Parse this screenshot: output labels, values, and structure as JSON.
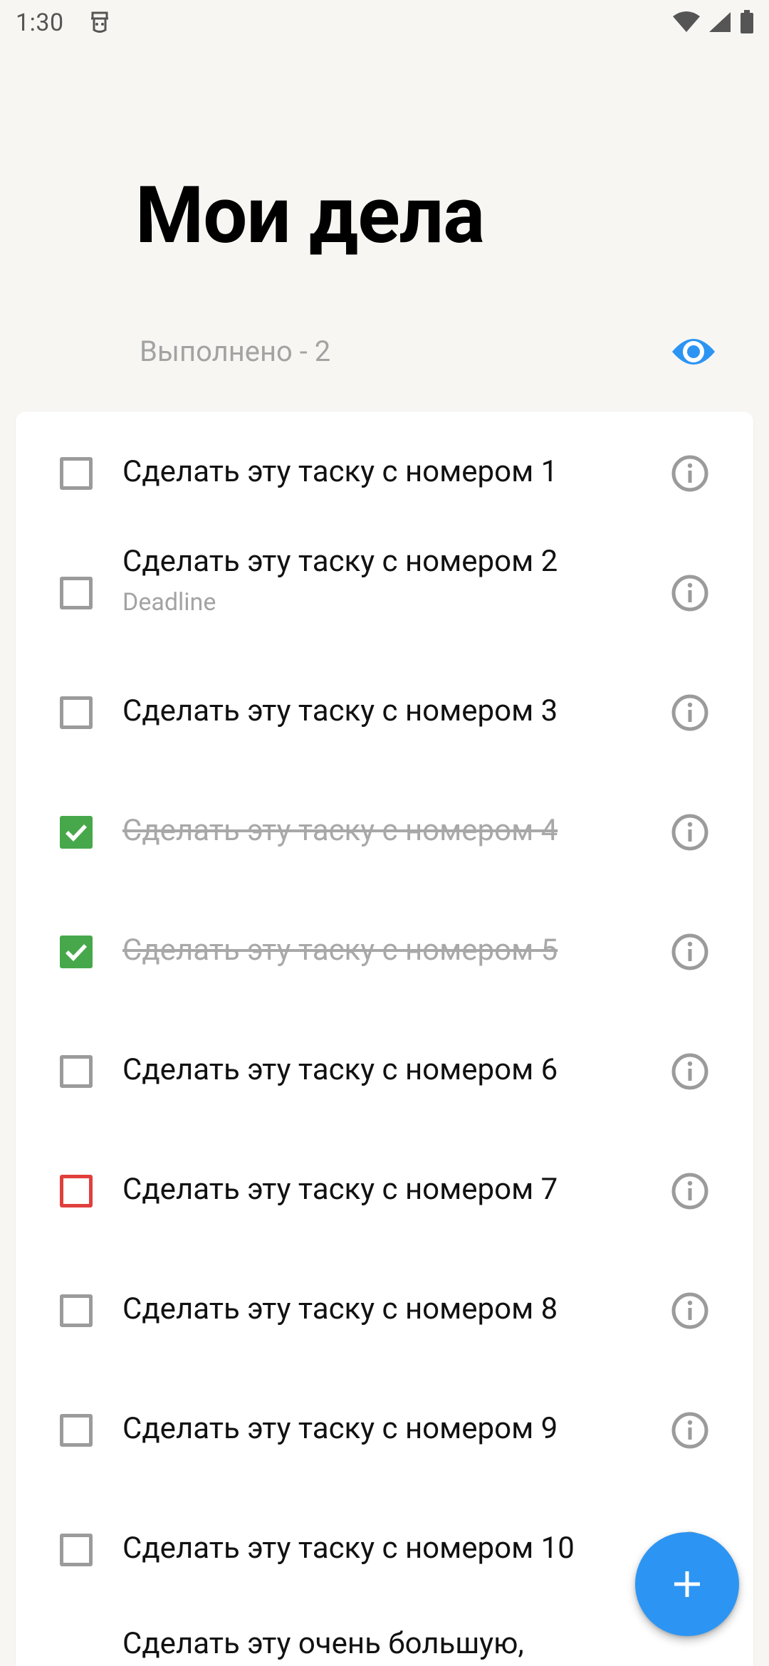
{
  "status_bar": {
    "time": "1:30"
  },
  "header": {
    "title": "Мои дела",
    "done_label": "Выполнено - 2",
    "visibility_icon": "eye-icon"
  },
  "tasks": [
    {
      "label": "Сделать эту таску с номером 1",
      "state": "unchecked"
    },
    {
      "label": "Сделать эту таску с номером 2",
      "subtitle": "Deadline",
      "state": "unchecked"
    },
    {
      "label": "Сделать эту таску с номером 3",
      "state": "unchecked"
    },
    {
      "label": "Сделать эту таску с номером 4",
      "state": "checked"
    },
    {
      "label": "Сделать эту таску с номером 5",
      "state": "checked"
    },
    {
      "label": "Сделать эту таску с номером 6",
      "state": "unchecked"
    },
    {
      "label": "Сделать эту таску с номером 7",
      "state": "overdue"
    },
    {
      "label": "Сделать эту таску с номером 8",
      "state": "unchecked"
    },
    {
      "label": "Сделать эту таску с номером 9",
      "state": "unchecked"
    },
    {
      "label": "Сделать эту таску с номером 10",
      "state": "unchecked"
    },
    {
      "label": "Сделать эту очень большую,",
      "state": "unchecked"
    }
  ],
  "fab": {
    "icon": "plus-icon"
  },
  "colors": {
    "background": "#F7F6F2",
    "accent": "#2C95F3",
    "checked": "#47A84B",
    "overdue": "#E0403C",
    "muted_text": "#A3A3A3"
  }
}
